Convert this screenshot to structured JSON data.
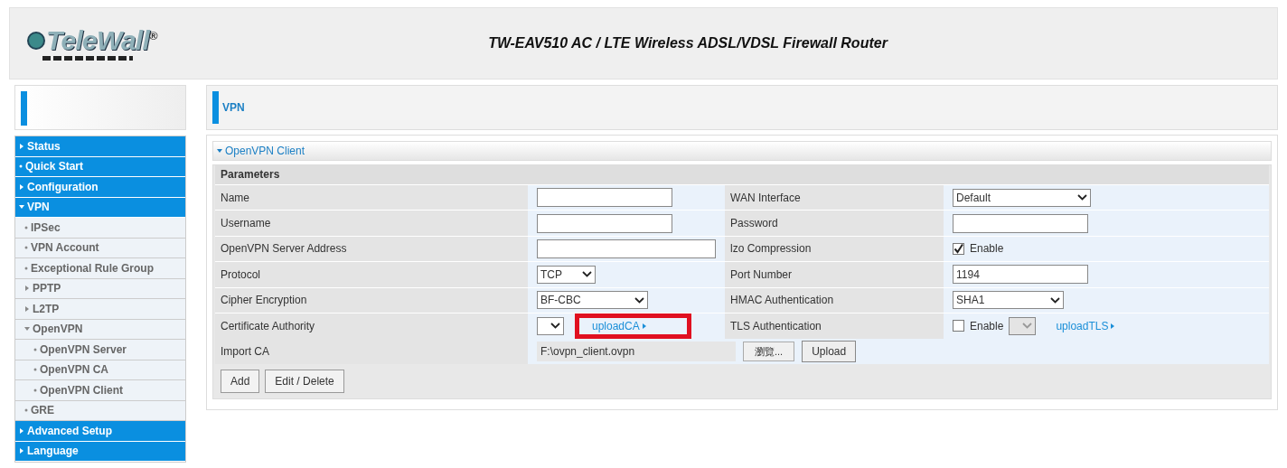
{
  "header": {
    "logo": "TeleWall",
    "logo_mark": "®",
    "title": "TW-EAV510 AC / LTE Wireless ADSL/VDSL Firewall Router"
  },
  "sidebar": {
    "items": [
      {
        "label": "Status",
        "expandable": true,
        "expanded": false
      },
      {
        "label": "Quick Start",
        "expandable": false
      },
      {
        "label": "Configuration",
        "expandable": true,
        "expanded": false
      },
      {
        "label": "VPN",
        "expandable": true,
        "expanded": true,
        "children": [
          {
            "label": "IPSec",
            "expandable": false
          },
          {
            "label": "VPN Account",
            "expandable": false
          },
          {
            "label": "Exceptional Rule Group",
            "expandable": false
          },
          {
            "label": "PPTP",
            "expandable": true,
            "expanded": false
          },
          {
            "label": "L2TP",
            "expandable": true,
            "expanded": false
          },
          {
            "label": "OpenVPN",
            "expandable": true,
            "expanded": true,
            "children": [
              {
                "label": "OpenVPN Server",
                "expandable": false
              },
              {
                "label": "OpenVPN CA",
                "expandable": false
              },
              {
                "label": "OpenVPN Client",
                "expandable": false
              }
            ]
          },
          {
            "label": "GRE",
            "expandable": false
          }
        ]
      },
      {
        "label": "Advanced Setup",
        "expandable": true,
        "expanded": false
      },
      {
        "label": "Language",
        "expandable": true,
        "expanded": false
      }
    ]
  },
  "page": {
    "title": "VPN",
    "section": {
      "title": "OpenVPN Client",
      "expanded": true,
      "subtitle": "Parameters",
      "rows": [
        [
          {
            "label": "Name",
            "kind": "text"
          },
          {
            "label": "WAN Interface",
            "kind": "select",
            "value": "Default"
          }
        ],
        [
          {
            "label": "Username",
            "kind": "text"
          },
          {
            "label": "Password",
            "kind": "text"
          }
        ],
        [
          {
            "label": "OpenVPN Server Address",
            "kind": "text"
          },
          {
            "label": "lzo Compression",
            "kind": "checkbox",
            "checked": true,
            "text": "Enable"
          }
        ],
        [
          {
            "label": "Protocol",
            "kind": "select",
            "value": "TCP"
          },
          {
            "label": "Port Number",
            "kind": "text",
            "value": "1194"
          }
        ],
        [
          {
            "label": "Cipher Encryption",
            "kind": "select",
            "value": "BF-CBC"
          },
          {
            "label": "HMAC Authentication",
            "kind": "select",
            "value": "SHA1"
          }
        ],
        [
          {
            "label": "Certificate Authority",
            "kind": "select-link",
            "link": "uploadCA",
            "highlighted": true
          },
          {
            "label": "TLS Authentication",
            "kind": "checkbox-select-link",
            "checked": false,
            "text": "Enable",
            "link": "uploadTLS"
          }
        ],
        [
          {
            "label": "Import CA",
            "kind": "file",
            "value": "F:\\ovpn_client.ovpn",
            "browse": "瀏覽...",
            "upload": "Upload"
          }
        ]
      ],
      "buttons": [
        "Add",
        "Edit / Delete"
      ]
    }
  }
}
